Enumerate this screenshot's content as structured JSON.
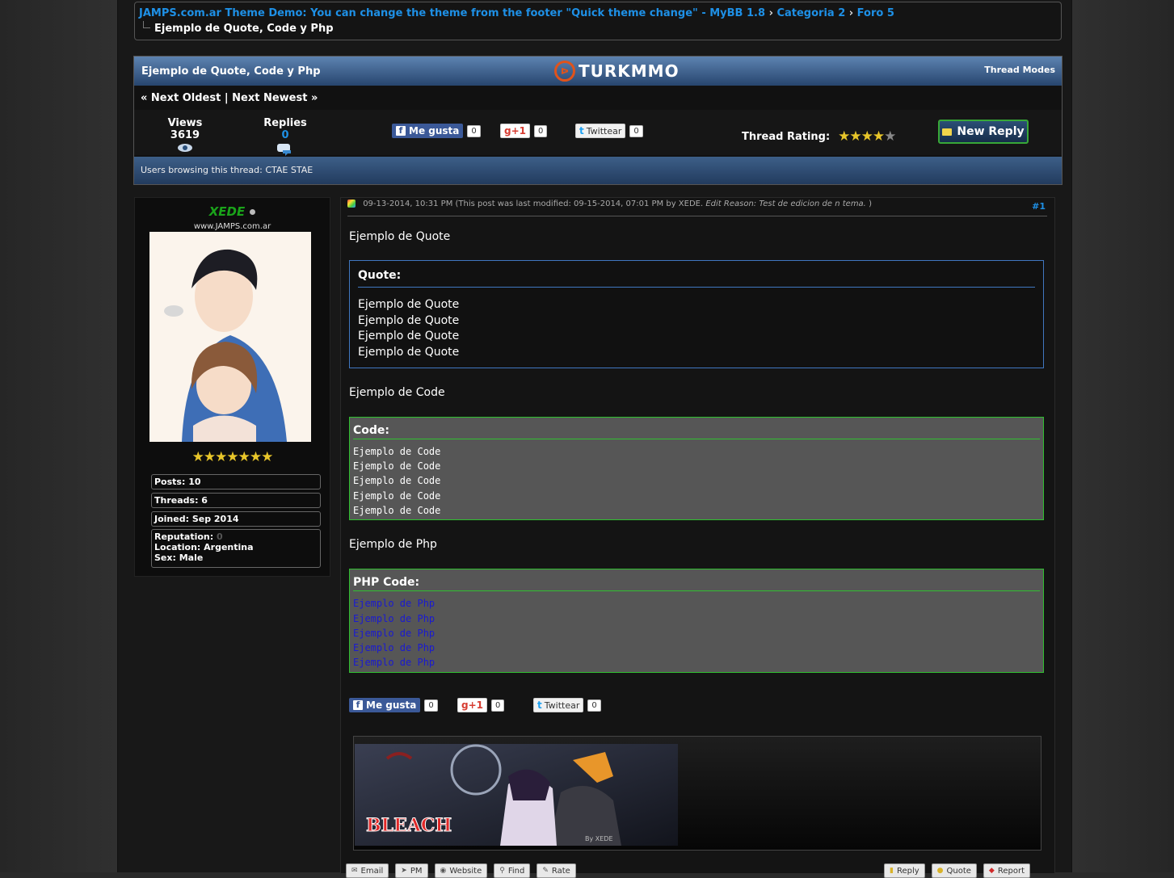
{
  "breadcrumb": {
    "forum": "JAMPS.com.ar Theme Demo: You can change the theme from the footer \"Quick theme change\" - MyBB 1.8",
    "category": "Categoria 2",
    "subforum": "Foro 5",
    "current": "Ejemplo de Quote, Code y Php"
  },
  "thread": {
    "title": "Ejemplo de Quote, Code y Php",
    "logo_text": "TURKMMO",
    "modes_label": "Thread Modes",
    "next_oldest": "« Next Oldest",
    "nav_separator": "|",
    "next_newest": "Next Newest »",
    "views_label": "Views",
    "views_value": "3619",
    "replies_label": "Replies",
    "replies_value": "0",
    "rating_label": "Thread Rating:",
    "rating_value": 4,
    "rating_max": 5,
    "new_reply_label": "New Reply",
    "browsing_text": "Users browsing this thread: CTAE STAE"
  },
  "share": {
    "fb_label": "Me gusta",
    "fb_count": "0",
    "gplus_label": "+1",
    "gplus_count": "0",
    "twitter_label": "Twittear",
    "twitter_count": "0"
  },
  "user": {
    "name": "XEDE",
    "site": "www.JAMPS.com.ar",
    "posts": "Posts: 10",
    "threads": "Threads: 6",
    "joined": "Joined: Sep 2014",
    "reputation_label": "Reputation:",
    "reputation_value": "0",
    "location": "Location: Argentina",
    "sex": "Sex: Male",
    "stars": 7
  },
  "post": {
    "date": "09-13-2014, 10:31 PM",
    "modified": "(This post was last modified: 09-15-2014, 07:01 PM by XEDE.",
    "edit_reason": "Edit Reason: Test de edicion de n tema.",
    "modified_end": ")",
    "number": "#1",
    "intro_quote": "Ejemplo de Quote",
    "quote_title": "Quote:",
    "quote_lines": [
      "Ejemplo de Quote",
      "Ejemplo de Quote",
      "Ejemplo de Quote",
      "Ejemplo de Quote"
    ],
    "intro_code": "Ejemplo de Code",
    "code_title": "Code:",
    "code_lines": [
      "Ejemplo de Code",
      "Ejemplo de Code",
      "Ejemplo de Code",
      "Ejemplo de Code",
      "Ejemplo de Code"
    ],
    "intro_php": "Ejemplo de Php",
    "php_title": "PHP Code:",
    "php_lines": [
      "Ejemplo de Php",
      "Ejemplo de Php",
      "Ejemplo de Php",
      "Ejemplo de Php",
      "Ejemplo de Php"
    ],
    "signature_text": "By XEDE",
    "signature_logo": "BLEACH",
    "buttons_left": [
      "Email",
      "PM",
      "Website",
      "Find",
      "Rate"
    ],
    "buttons_right": [
      "Reply",
      "Quote",
      "Report"
    ]
  },
  "colors": {
    "link": "#1e90e6",
    "username": "#1aa31a",
    "quote_border": "#4077c0",
    "code_border": "#30c030",
    "php_text": "#1a1ad0"
  }
}
